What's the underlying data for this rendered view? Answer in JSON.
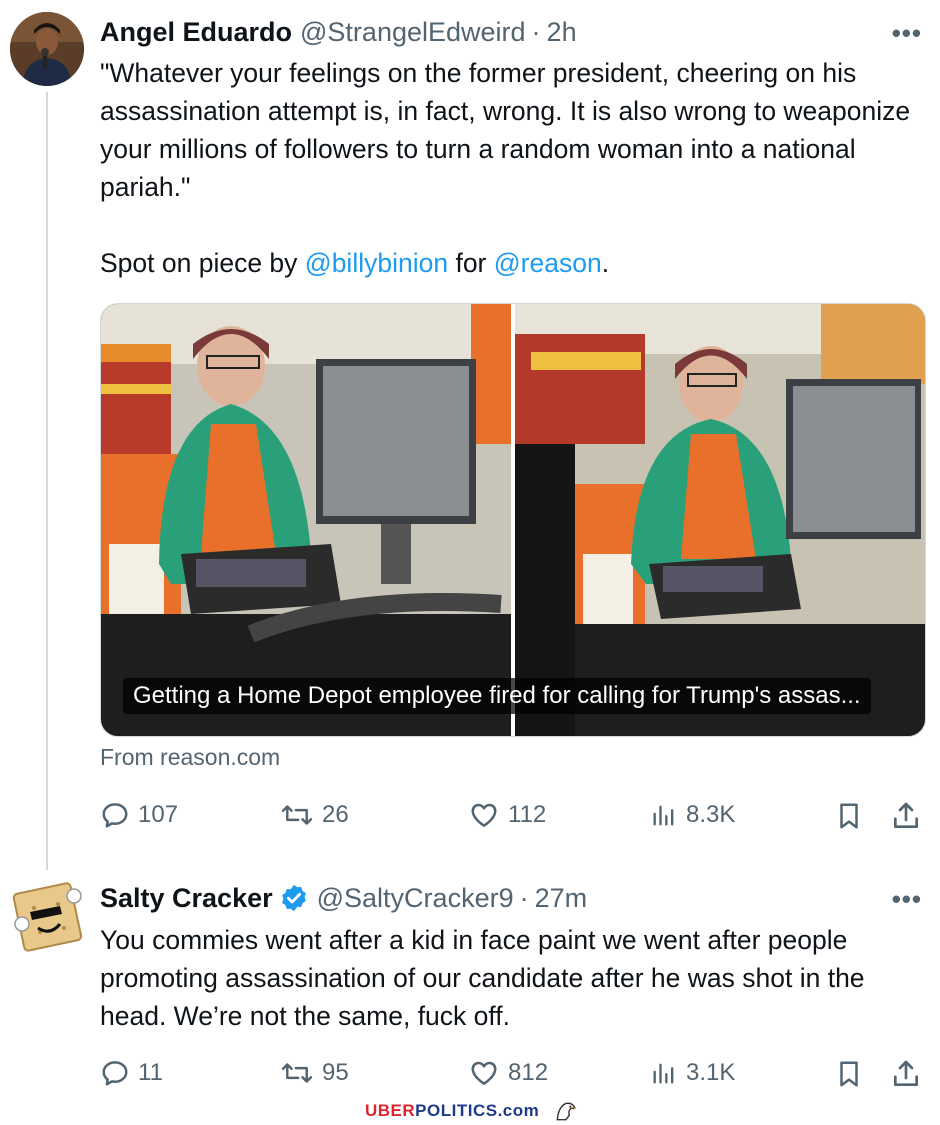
{
  "tweets": [
    {
      "name": "Angel Eduardo",
      "handle": "@StrangelEdweird",
      "time": "2h",
      "body_quote": "\"Whatever your feelings on the former president, cheering on his assassination attempt is, in fact, wrong. It is also wrong to weaponize your millions of followers to turn a random woman into a national pariah.\"",
      "body_prefix": "Spot on piece by",
      "mention1": "@billybinion",
      "body_mid": "for",
      "mention2": "@reason",
      "body_suffix": ".",
      "media_caption": "Getting a Home Depot employee fired for calling for Trump's assas...",
      "source": "From reason.com",
      "replies": "107",
      "retweets": "26",
      "likes": "112",
      "views": "8.3K"
    },
    {
      "name": "Salty Cracker",
      "verified": true,
      "handle": "@SaltyCracker9",
      "time": "27m",
      "body": "You commies went after a kid in face paint we went after people promoting assassination of our candidate after he was shot in the head. We’re not the same, fuck off.",
      "replies": "11",
      "retweets": "95",
      "likes": "812",
      "views": "3.1K"
    }
  ],
  "common": {
    "dot": "·",
    "more": "•••"
  },
  "watermark": {
    "part1": "UBER",
    "part2": "POLITICS.com"
  },
  "colors": {
    "link": "#1d9bf0",
    "muted": "#536471",
    "verified": "#1d9bf0",
    "apron": "#e8702a",
    "shirt": "#2aa07a"
  }
}
